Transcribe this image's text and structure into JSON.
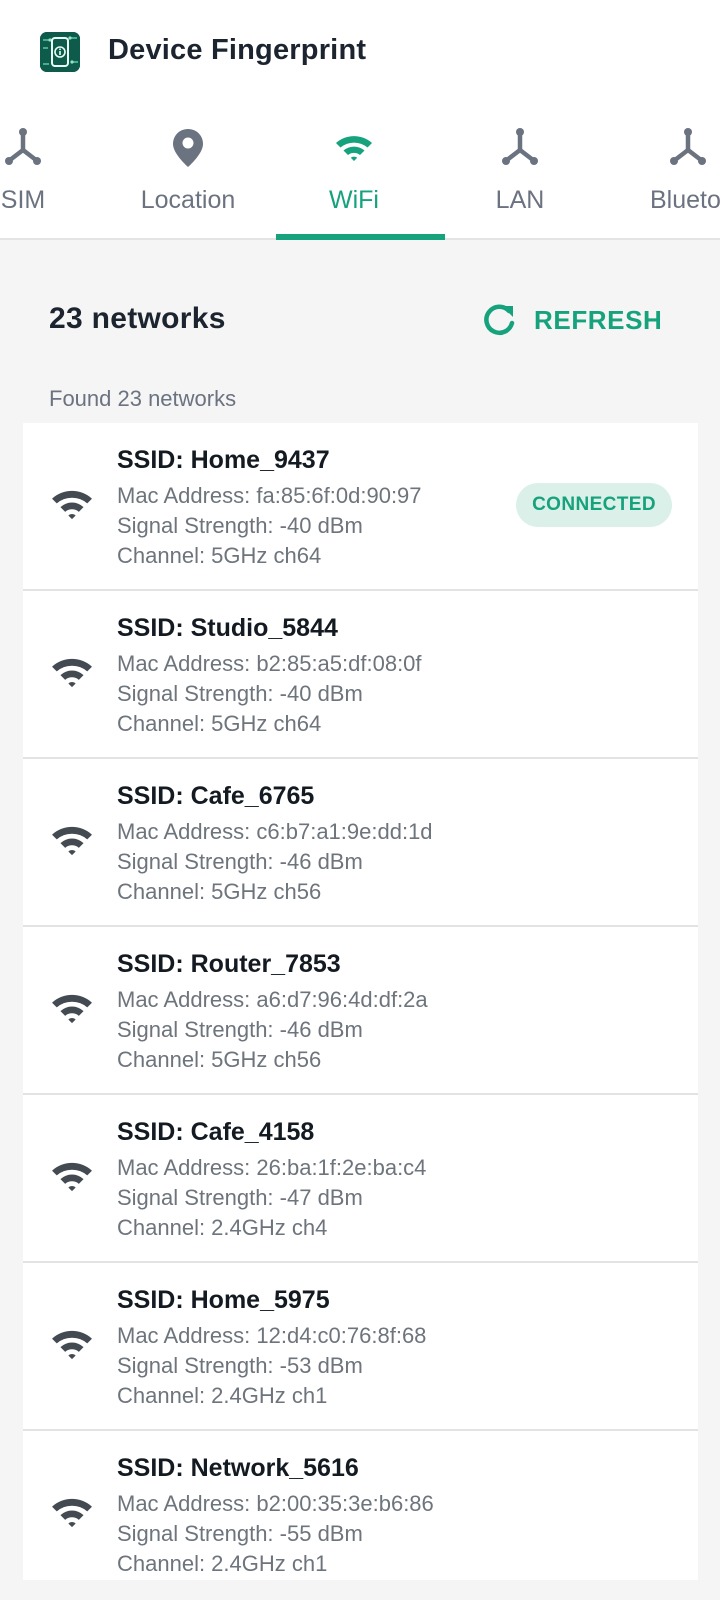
{
  "app": {
    "title": "Device Fingerprint",
    "accent_color": "#15a27c"
  },
  "tabs": [
    {
      "label": "SIM",
      "icon": "network-icon",
      "active": false
    },
    {
      "label": "Location",
      "icon": "location-pin-icon",
      "active": false
    },
    {
      "label": "WiFi",
      "icon": "wifi-icon",
      "active": true
    },
    {
      "label": "LAN",
      "icon": "network-icon",
      "active": false
    },
    {
      "label": "Blueto",
      "icon": "network-icon",
      "active": false
    }
  ],
  "summary": {
    "count_label": "23 networks",
    "refresh_label": "REFRESH",
    "found_label": "Found 23 networks"
  },
  "networks": [
    {
      "ssid": "SSID: Home_9437",
      "mac": "Mac Address: fa:85:6f:0d:90:97",
      "signal": "Signal Strength: -40 dBm",
      "channel": "Channel: 5GHz ch64",
      "badge": "CONNECTED"
    },
    {
      "ssid": "SSID: Studio_5844",
      "mac": "Mac Address: b2:85:a5:df:08:0f",
      "signal": "Signal Strength: -40 dBm",
      "channel": "Channel: 5GHz ch64"
    },
    {
      "ssid": "SSID: Cafe_6765",
      "mac": "Mac Address: c6:b7:a1:9e:dd:1d",
      "signal": "Signal Strength: -46 dBm",
      "channel": "Channel: 5GHz ch56"
    },
    {
      "ssid": "SSID: Router_7853",
      "mac": "Mac Address: a6:d7:96:4d:df:2a",
      "signal": "Signal Strength: -46 dBm",
      "channel": "Channel: 5GHz ch56"
    },
    {
      "ssid": "SSID: Cafe_4158",
      "mac": "Mac Address: 26:ba:1f:2e:ba:c4",
      "signal": "Signal Strength: -47 dBm",
      "channel": "Channel: 2.4GHz ch4"
    },
    {
      "ssid": "SSID: Home_5975",
      "mac": "Mac Address: 12:d4:c0:76:8f:68",
      "signal": "Signal Strength: -53 dBm",
      "channel": "Channel: 2.4GHz ch1"
    },
    {
      "ssid": "SSID: Network_5616",
      "mac": "Mac Address: b2:00:35:3e:b6:86",
      "signal": "Signal Strength: -55 dBm",
      "channel": "Channel: 2.4GHz ch1"
    }
  ]
}
